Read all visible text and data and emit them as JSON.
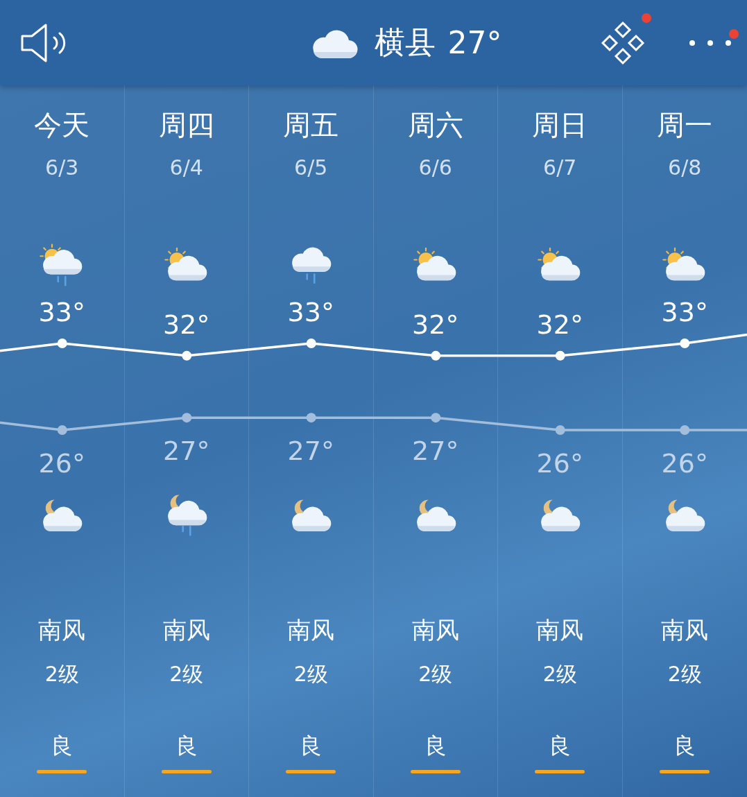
{
  "header": {
    "weather_icon": {
      "kind": "cloud"
    },
    "city": "横县",
    "temperature": "27°",
    "actions": [
      {
        "kind": "apps",
        "badge": true
      },
      {
        "kind": "more",
        "badge": true
      }
    ]
  },
  "days": [
    {
      "day": "今天",
      "day_icon": {
        "kind": "sun-cloud-rain"
      },
      "night_icon": {
        "kind": "moon-cloud"
      },
      "wind": "南风",
      "wind_level": "2级",
      "air_quality": "良"
    },
    {
      "day": "周四",
      "day_icon": {
        "kind": "sun-cloud"
      },
      "night_icon": {
        "kind": "moon-cloud-rain"
      },
      "wind": "南风",
      "wind_level": "2级",
      "air_quality": "良"
    },
    {
      "day": "周五",
      "day_icon": {
        "kind": "cloud-rain"
      },
      "night_icon": {
        "kind": "moon-cloud"
      },
      "wind": "南风",
      "wind_level": "2级",
      "air_quality": "良"
    },
    {
      "day": "周六",
      "day_icon": {
        "kind": "sun-cloud"
      },
      "night_icon": {
        "kind": "moon-cloud"
      },
      "wind": "南风",
      "wind_level": "2级",
      "air_quality": "良"
    },
    {
      "day": "周日",
      "day_icon": {
        "kind": "sun-cloud"
      },
      "night_icon": {
        "kind": "moon-cloud"
      },
      "wind": "南风",
      "wind_level": "2级",
      "air_quality": "良"
    },
    {
      "day": "周一",
      "day_icon": {
        "kind": "sun-cloud"
      },
      "night_icon": {
        "kind": "moon-cloud"
      },
      "wind": "南风",
      "wind_level": "2级",
      "air_quality": "良"
    }
  ],
  "chart_data": {
    "type": "line",
    "categories": [
      "6/3",
      "6/4",
      "6/5",
      "6/6",
      "6/7",
      "6/8"
    ],
    "series": [
      {
        "marker": true,
        "color": "#ffffff",
        "values": [
          33,
          32,
          33,
          32,
          32,
          33
        ],
        "value_labels": [
          "33°",
          "32°",
          "33°",
          "32°",
          "32°",
          "33°"
        ]
      },
      {
        "marker": true,
        "color": "#a3bedc",
        "values": [
          26,
          27,
          27,
          27,
          26,
          26
        ],
        "value_labels": [
          "26°",
          "27°",
          "27°",
          "27°",
          "26°",
          "26°"
        ]
      }
    ]
  }
}
